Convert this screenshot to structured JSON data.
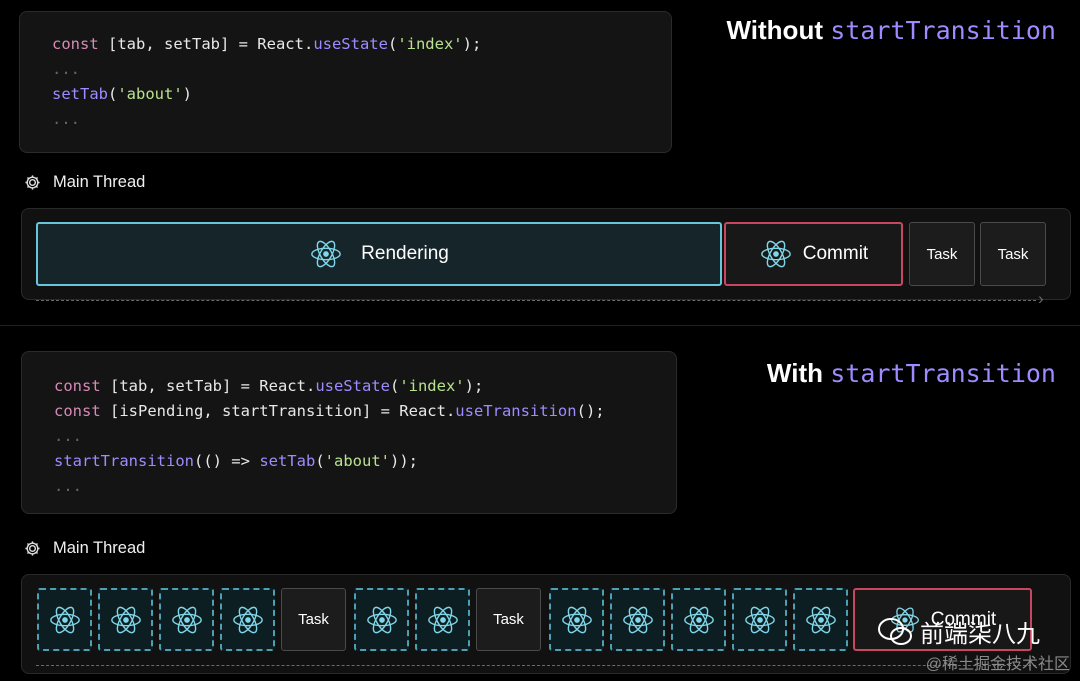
{
  "top": {
    "title_prefix": "Without",
    "title_code": "startTransition",
    "code_lines": [
      [
        [
          "kw",
          "const"
        ],
        [
          "txt",
          " [tab, setTab] = React."
        ],
        [
          "fn",
          "useState"
        ],
        [
          "txt",
          "("
        ],
        [
          "str",
          "'index'"
        ],
        [
          "txt",
          ");"
        ]
      ],
      [
        [
          "dim",
          "..."
        ]
      ],
      [
        [
          "fn",
          "setTab"
        ],
        [
          "txt",
          "("
        ],
        [
          "str",
          "'about'"
        ],
        [
          "txt",
          ")"
        ]
      ],
      [
        [
          "dim",
          "..."
        ]
      ]
    ],
    "thread_label": "Main Thread",
    "rendering_label": "Rendering",
    "commit_label": "Commit",
    "task_labels": [
      "Task",
      "Task"
    ]
  },
  "bottom": {
    "title_prefix": "With",
    "title_code": "startTransition",
    "code_lines": [
      [
        [
          "kw",
          "const"
        ],
        [
          "txt",
          " [tab, setTab] = React."
        ],
        [
          "fn",
          "useState"
        ],
        [
          "txt",
          "("
        ],
        [
          "str",
          "'index'"
        ],
        [
          "txt",
          ");"
        ]
      ],
      [
        [
          "kw",
          "const"
        ],
        [
          "txt",
          " [isPending, startTransition] = React."
        ],
        [
          "fn",
          "useTransition"
        ],
        [
          "txt",
          "();"
        ]
      ],
      [
        [
          "dim",
          "..."
        ]
      ],
      [
        [
          "fn",
          "startTransition"
        ],
        [
          "txt",
          "(() => "
        ],
        [
          "fn",
          "setTab"
        ],
        [
          "txt",
          "("
        ],
        [
          "str",
          "'about'"
        ],
        [
          "txt",
          "));"
        ]
      ],
      [
        [
          "dim",
          "..."
        ]
      ]
    ],
    "thread_label": "Main Thread",
    "commit_label": "Commit",
    "sequence": [
      "r",
      "r",
      "r",
      "r",
      "Task",
      "r",
      "r",
      "Task",
      "r",
      "r",
      "r",
      "r",
      "r"
    ]
  },
  "watermark": {
    "account": "前端柒八九",
    "source": "@稀土掘金技术社区"
  },
  "colors": {
    "accent_purple": "#9f8bff",
    "rendering_border": "#69c6d8",
    "commit_border": "#c8465f"
  }
}
